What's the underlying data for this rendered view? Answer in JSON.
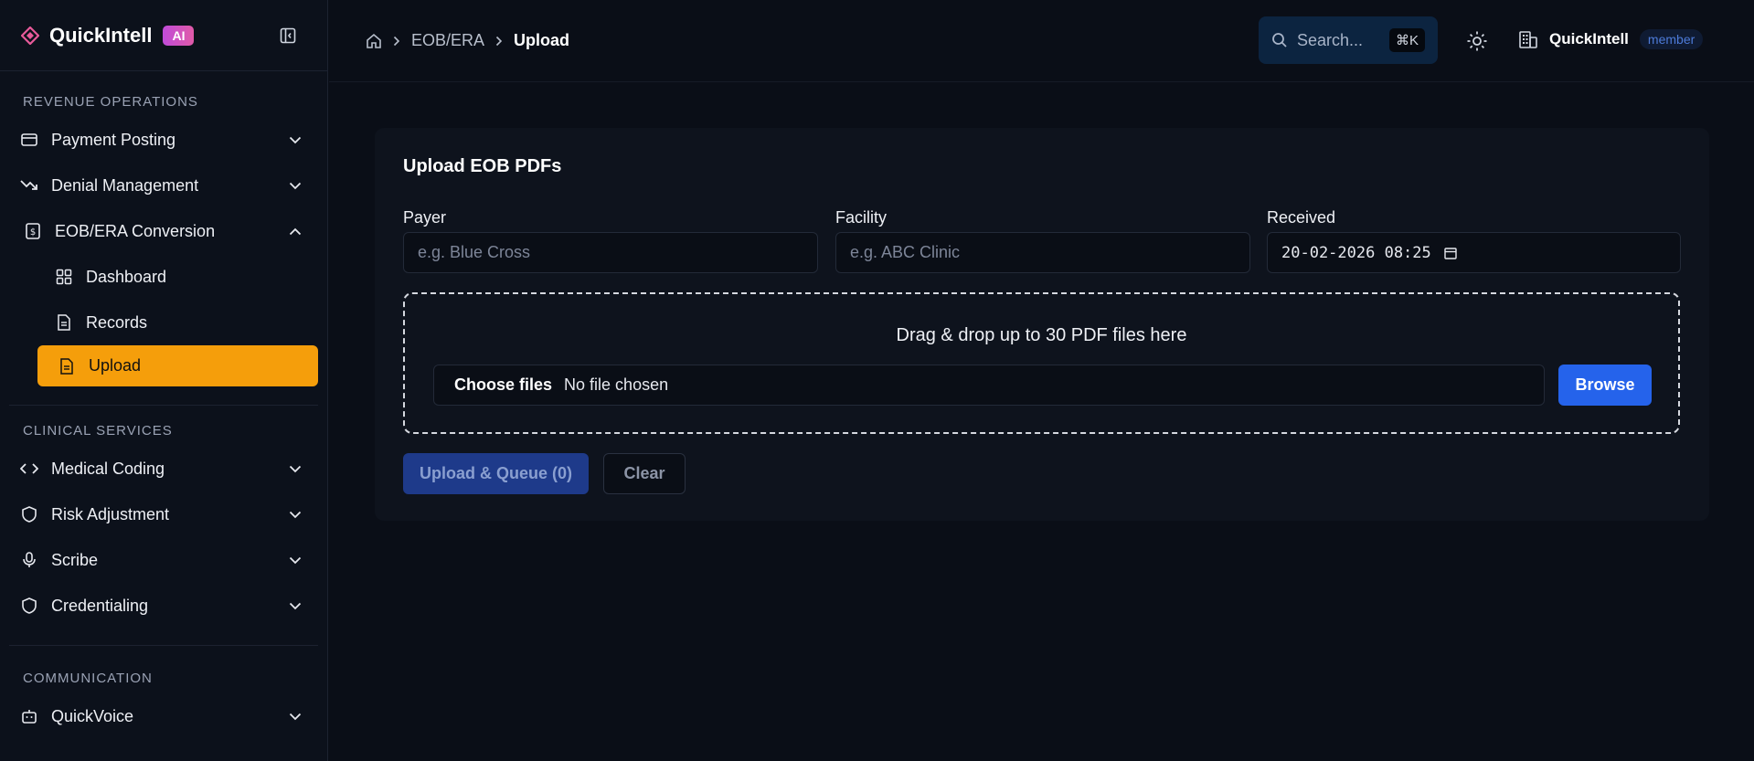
{
  "brand": {
    "name": "QuickIntell",
    "badge": "AI"
  },
  "sidebar": {
    "sections": [
      {
        "title": "REVENUE OPERATIONS"
      },
      {
        "title": "CLINICAL SERVICES"
      },
      {
        "title": "COMMUNICATION"
      }
    ],
    "revenue": [
      {
        "label": "Payment Posting",
        "icon": "credit-card-icon"
      },
      {
        "label": "Denial Management",
        "icon": "trending-down-icon"
      },
      {
        "label": "EOB/ERA Conversion",
        "icon": "dollar-file-icon"
      }
    ],
    "eob_sub": [
      {
        "label": "Dashboard",
        "icon": "layout-grid-icon"
      },
      {
        "label": "Records",
        "icon": "file-text-icon"
      },
      {
        "label": "Upload",
        "icon": "file-text-icon"
      }
    ],
    "clinical": [
      {
        "label": "Medical Coding",
        "icon": "code-icon"
      },
      {
        "label": "Risk Adjustment",
        "icon": "shield-icon"
      },
      {
        "label": "Scribe",
        "icon": "microphone-icon"
      },
      {
        "label": "Credentialing",
        "icon": "shield-icon"
      }
    ],
    "communication": [
      {
        "label": "QuickVoice",
        "icon": "bot-icon"
      }
    ]
  },
  "breadcrumb": {
    "items": [
      "EOB/ERA",
      "Upload"
    ]
  },
  "search": {
    "placeholder": "Search...",
    "shortcut": "⌘K"
  },
  "org": {
    "name": "QuickIntell",
    "role": "member"
  },
  "card": {
    "title": "Upload EOB PDFs",
    "payer": {
      "label": "Payer",
      "placeholder": "e.g. Blue Cross"
    },
    "facility": {
      "label": "Facility",
      "placeholder": "e.g. ABC Clinic"
    },
    "received": {
      "label": "Received",
      "value": "20-02-2026 08:25"
    },
    "dropzone_text": "Drag & drop up to 30 PDF files here",
    "choose_files": "Choose files",
    "no_file": "No file chosen",
    "browse": "Browse",
    "upload": "Upload & Queue (0)",
    "clear": "Clear"
  },
  "colors": {
    "accent": "#f59e0b",
    "primary": "#2563eb",
    "background": "#0a0e17"
  }
}
